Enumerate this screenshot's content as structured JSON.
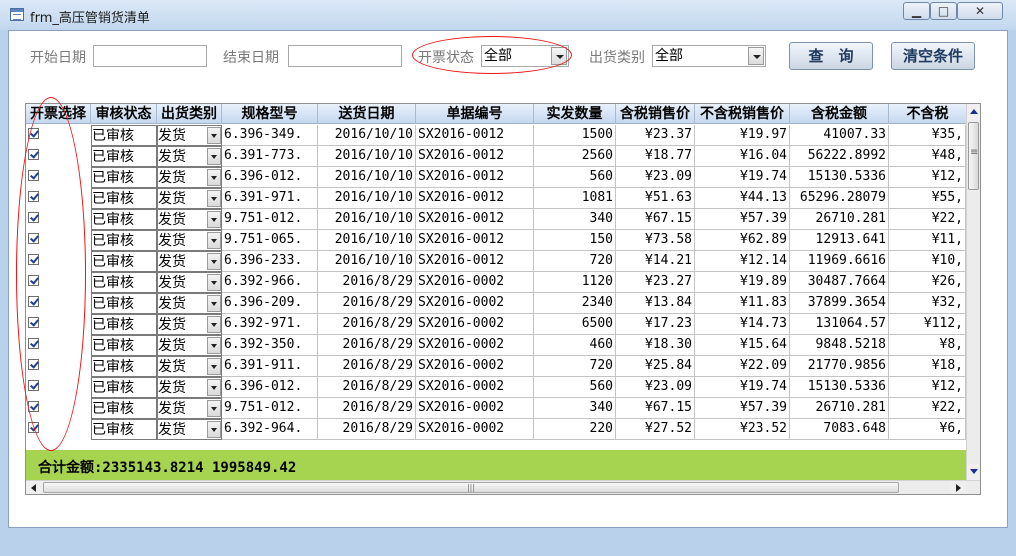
{
  "window": {
    "title": "frm_高压管销货清单",
    "minimize_glyph": "▁",
    "maximize_glyph": "□",
    "close_glyph": "✕"
  },
  "filters": {
    "start_date_label": "开始日期",
    "start_date_value": "",
    "end_date_label": "结束日期",
    "end_date_value": "",
    "invoice_status_label": "开票状态",
    "invoice_status_value": "全部",
    "ship_type_label": "出货类别",
    "ship_type_value": "全部",
    "query_button": "查　询",
    "clear_button": "清空条件"
  },
  "grid": {
    "columns": [
      "开票选择",
      "审核状态",
      "出货类别",
      "规格型号",
      "送货日期",
      "单据编号",
      "实发数量",
      "含税销售价",
      "不含税销售价",
      "含税金额",
      "不含税"
    ],
    "rows": [
      {
        "checked": true,
        "audit": "已审核",
        "ship": "发货",
        "spec": "6.396-349.",
        "date": "2016/10/10",
        "doc": "SX2016-0012",
        "qty": "1500",
        "price_tax": "¥23.37",
        "price_notax": "¥19.97",
        "amount_tax": "41007.33",
        "amount_notax": "¥35,"
      },
      {
        "checked": true,
        "audit": "已审核",
        "ship": "发货",
        "spec": "6.391-773.",
        "date": "2016/10/10",
        "doc": "SX2016-0012",
        "qty": "2560",
        "price_tax": "¥18.77",
        "price_notax": "¥16.04",
        "amount_tax": "56222.8992",
        "amount_notax": "¥48,"
      },
      {
        "checked": true,
        "audit": "已审核",
        "ship": "发货",
        "spec": "6.396-012.",
        "date": "2016/10/10",
        "doc": "SX2016-0012",
        "qty": "560",
        "price_tax": "¥23.09",
        "price_notax": "¥19.74",
        "amount_tax": "15130.5336",
        "amount_notax": "¥12,"
      },
      {
        "checked": true,
        "audit": "已审核",
        "ship": "发货",
        "spec": "6.391-971.",
        "date": "2016/10/10",
        "doc": "SX2016-0012",
        "qty": "1081",
        "price_tax": "¥51.63",
        "price_notax": "¥44.13",
        "amount_tax": "65296.28079",
        "amount_notax": "¥55,"
      },
      {
        "checked": true,
        "audit": "已审核",
        "ship": "发货",
        "spec": "9.751-012.",
        "date": "2016/10/10",
        "doc": "SX2016-0012",
        "qty": "340",
        "price_tax": "¥67.15",
        "price_notax": "¥57.39",
        "amount_tax": "26710.281",
        "amount_notax": "¥22,"
      },
      {
        "checked": true,
        "audit": "已审核",
        "ship": "发货",
        "spec": "9.751-065.",
        "date": "2016/10/10",
        "doc": "SX2016-0012",
        "qty": "150",
        "price_tax": "¥73.58",
        "price_notax": "¥62.89",
        "amount_tax": "12913.641",
        "amount_notax": "¥11,"
      },
      {
        "checked": true,
        "audit": "已审核",
        "ship": "发货",
        "spec": "6.396-233.",
        "date": "2016/10/10",
        "doc": "SX2016-0012",
        "qty": "720",
        "price_tax": "¥14.21",
        "price_notax": "¥12.14",
        "amount_tax": "11969.6616",
        "amount_notax": "¥10,"
      },
      {
        "checked": true,
        "audit": "已审核",
        "ship": "发货",
        "spec": "6.392-966.",
        "date": "2016/8/29",
        "doc": "SX2016-0002",
        "qty": "1120",
        "price_tax": "¥23.27",
        "price_notax": "¥19.89",
        "amount_tax": "30487.7664",
        "amount_notax": "¥26,"
      },
      {
        "checked": true,
        "audit": "已审核",
        "ship": "发货",
        "spec": "6.396-209.",
        "date": "2016/8/29",
        "doc": "SX2016-0002",
        "qty": "2340",
        "price_tax": "¥13.84",
        "price_notax": "¥11.83",
        "amount_tax": "37899.3654",
        "amount_notax": "¥32,"
      },
      {
        "checked": true,
        "audit": "已审核",
        "ship": "发货",
        "spec": "6.392-971.",
        "date": "2016/8/29",
        "doc": "SX2016-0002",
        "qty": "6500",
        "price_tax": "¥17.23",
        "price_notax": "¥14.73",
        "amount_tax": "131064.57",
        "amount_notax": "¥112,"
      },
      {
        "checked": true,
        "audit": "已审核",
        "ship": "发货",
        "spec": "6.392-350.",
        "date": "2016/8/29",
        "doc": "SX2016-0002",
        "qty": "460",
        "price_tax": "¥18.30",
        "price_notax": "¥15.64",
        "amount_tax": "9848.5218",
        "amount_notax": "¥8,"
      },
      {
        "checked": true,
        "audit": "已审核",
        "ship": "发货",
        "spec": "6.391-911.",
        "date": "2016/8/29",
        "doc": "SX2016-0002",
        "qty": "720",
        "price_tax": "¥25.84",
        "price_notax": "¥22.09",
        "amount_tax": "21770.9856",
        "amount_notax": "¥18,"
      },
      {
        "checked": true,
        "audit": "已审核",
        "ship": "发货",
        "spec": "6.396-012.",
        "date": "2016/8/29",
        "doc": "SX2016-0002",
        "qty": "560",
        "price_tax": "¥23.09",
        "price_notax": "¥19.74",
        "amount_tax": "15130.5336",
        "amount_notax": "¥12,"
      },
      {
        "checked": true,
        "audit": "已审核",
        "ship": "发货",
        "spec": "9.751-012.",
        "date": "2016/8/29",
        "doc": "SX2016-0002",
        "qty": "340",
        "price_tax": "¥67.15",
        "price_notax": "¥57.39",
        "amount_tax": "26710.281",
        "amount_notax": "¥22,"
      },
      {
        "checked": true,
        "audit": "已审核",
        "ship": "发货",
        "spec": "6.392-964.",
        "date": "2016/8/29",
        "doc": "SX2016-0002",
        "qty": "220",
        "price_tax": "¥27.52",
        "price_notax": "¥23.52",
        "amount_tax": "7083.648",
        "amount_notax": "¥6,"
      }
    ],
    "footer_total": "合计金额:2335143.8214 1995849.42"
  },
  "colors": {
    "annotation": "#e11111",
    "footer_bg": "#a6d451",
    "header_bg": "#c5d8ef"
  },
  "icons": {
    "window_icon": "form-icon",
    "dropdown": "chevron-down-icon",
    "checkbox": "checkbox-checked-icon"
  }
}
